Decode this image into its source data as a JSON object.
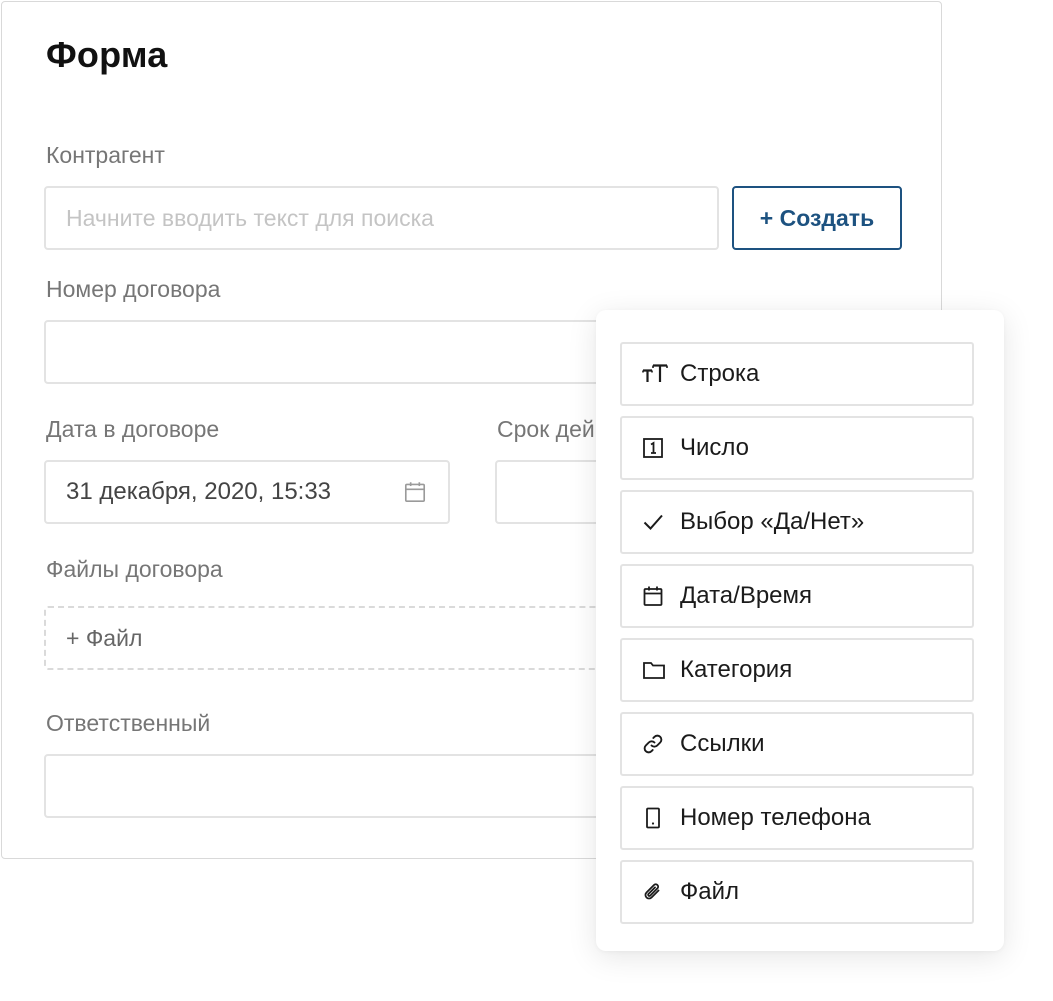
{
  "form": {
    "title": "Форма",
    "counterparty": {
      "label": "Контрагент",
      "placeholder": "Начните вводить текст для поиска",
      "value": "",
      "create_button": "+ Создать"
    },
    "contract_number": {
      "label": "Номер договора",
      "value": ""
    },
    "contract_date": {
      "label": "Дата в договоре",
      "value": "31 декабря, 2020, 15:33"
    },
    "term": {
      "label": "Срок дей",
      "value": ""
    },
    "contract_files": {
      "label": "Файлы договора",
      "add_file": "+ Файл"
    },
    "responsible": {
      "label": "Ответственный",
      "value": ""
    }
  },
  "field_types": [
    {
      "label": "Строка",
      "icon": "text-size-icon"
    },
    {
      "label": "Число",
      "icon": "number-icon"
    },
    {
      "label": "Выбор «Да/Нет»",
      "icon": "checkmark-icon"
    },
    {
      "label": "Дата/Время",
      "icon": "calendar-icon"
    },
    {
      "label": "Категория",
      "icon": "folder-icon"
    },
    {
      "label": "Ссылки",
      "icon": "link-icon"
    },
    {
      "label": "Номер телефона",
      "icon": "phone-icon"
    },
    {
      "label": "Файл",
      "icon": "paperclip-icon"
    }
  ],
  "colors": {
    "accent": "#1d5280",
    "label": "#767676",
    "border": "#e3e3e3"
  }
}
